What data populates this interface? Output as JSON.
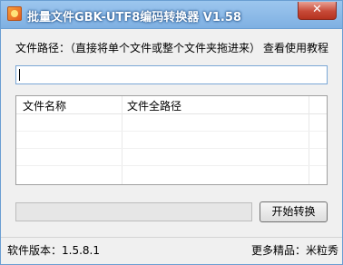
{
  "window": {
    "title": "批量文件GBK-UTF8编码转换器 V1.58",
    "close_label": "✕"
  },
  "form": {
    "path_label": "文件路径：（直接将单个文件或整个文件夹拖进来）",
    "help_link": "查看使用教程",
    "path_value": ""
  },
  "list": {
    "columns": [
      "文件名称",
      "文件全路径"
    ],
    "rows": []
  },
  "progress": {
    "value": 0
  },
  "actions": {
    "start_label": "开始转换"
  },
  "status": {
    "version_text": "软件版本：1.5.8.1",
    "more_text": "更多精品：米粒秀"
  }
}
